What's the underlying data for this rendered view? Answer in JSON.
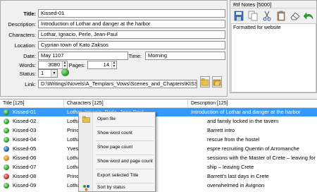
{
  "form": {
    "title_label": "Title:",
    "title_value": "Kissed-01",
    "description_label": "Description:",
    "description_value": "Introduction of Lothar and danger at the harbor",
    "characters_label": "Characters:",
    "characters_value": "Lothar, Ignacio, Perle, Jean-Paul",
    "location_label": "Location:",
    "location_value": "Cyprian town of Kato Zaksos",
    "date_label": "Date:",
    "date_value": "May 1107",
    "time_label": "Time:",
    "time_value": "Morning",
    "words_label": "Words:",
    "words_value": "3080",
    "pages_label": "Pages:",
    "pages_value": "14",
    "status_label": "Status:",
    "status_value": "1",
    "link_label": "Link:",
    "link_value": "D:\\Writings\\Novels\\A_Templars_Vows\\Scenes_and_Chapters\\KISSED CHAPTER"
  },
  "rtf": {
    "title": "Rtf Notes [5000]",
    "body": "Formatted for website"
  },
  "list": {
    "headers": [
      "Title [125]",
      "Characters [125]",
      "Description [125]"
    ],
    "rows": [
      {
        "title": "Kissed-01",
        "characters": "Lothar, Ignacio, Perle, Jean-Paul",
        "description": "Introduction of Lothar and danger at the harbor",
        "color": "#2f9e2f"
      },
      {
        "title": "Kissed-02",
        "characters": "Lothar",
        "description": "and family locked in the tavern",
        "color": "#2f9e2f"
      },
      {
        "title": "Kissed-03",
        "characters": "Prince",
        "description": "Barrett intro",
        "color": "#2f9e2f"
      },
      {
        "title": "Kissed-04",
        "characters": "Lothar",
        "description": "rescue from the hostel",
        "color": "#2f9e2f"
      },
      {
        "title": "Kissed-05",
        "characters": "Yves",
        "description": "espre recruiting Quentin of Arromanche",
        "color": "#1e5fb5"
      },
      {
        "title": "Kissed-06",
        "characters": "Lothar",
        "description": "sessions with the Master of Crete – leaving for France",
        "color": "#d98a1c"
      },
      {
        "title": "Kissed-07",
        "characters": "Lothar",
        "description": "ship – leaving Crete",
        "color": "#2f9e2f"
      },
      {
        "title": "Kissed-08",
        "characters": "Prince",
        "description": "Barrett's last days in Crete",
        "color": "#c9302c"
      },
      {
        "title": "Kissed-09",
        "characters": "Lothar",
        "description": "overwhelmed in Avignon",
        "color": "#2f9e2f"
      }
    ]
  },
  "context_menu": {
    "items": [
      "Open file",
      "Show word count",
      "Show page count",
      "Show word and page count",
      "Export selected Title",
      "Sort by status"
    ]
  }
}
